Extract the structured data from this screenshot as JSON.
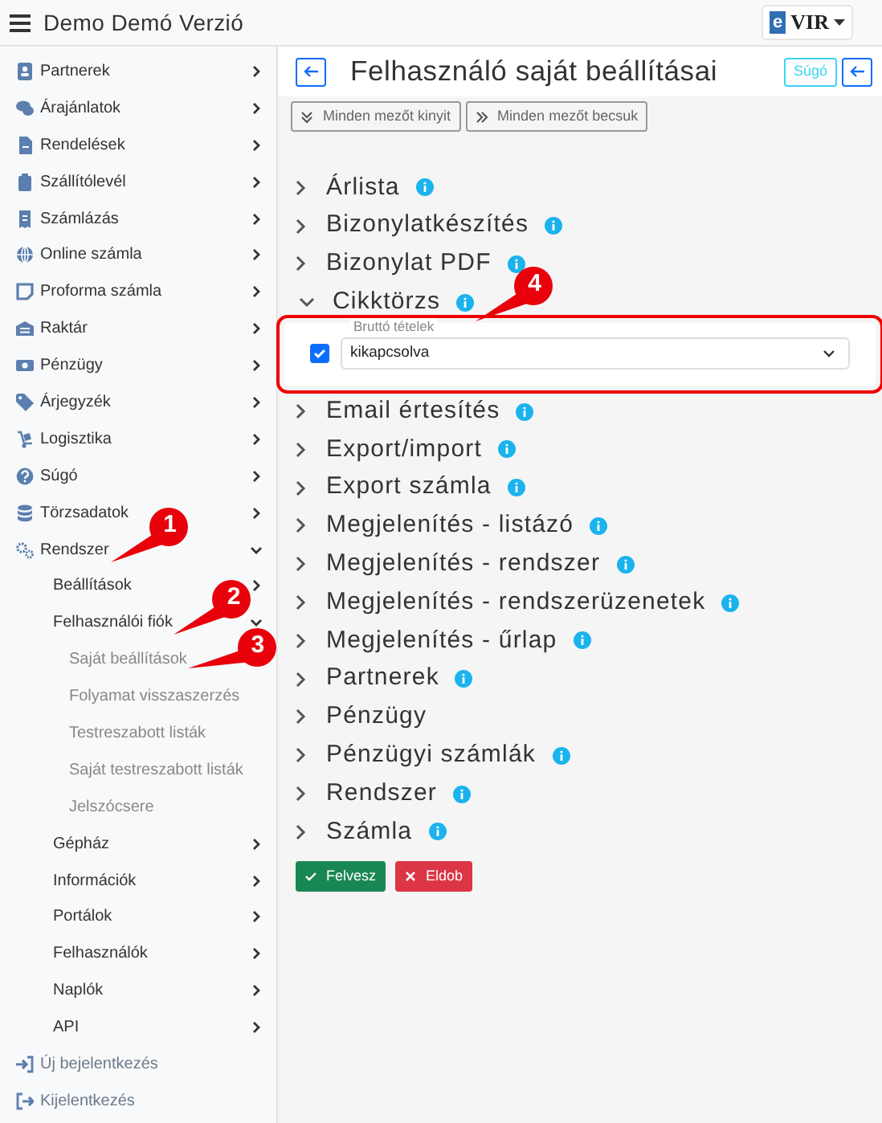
{
  "navbar": {
    "brand": "Demo Demó Verzió",
    "logo_mark": "e",
    "logo_text": "VIR"
  },
  "sidebar": {
    "items": [
      {
        "label": "Partnerek",
        "kind": "menu",
        "expanded": false
      },
      {
        "label": "Árajánlatok",
        "kind": "menu",
        "expanded": false
      },
      {
        "label": "Rendelések",
        "kind": "menu",
        "expanded": false
      },
      {
        "label": "Szállítólevél",
        "kind": "menu",
        "expanded": false
      },
      {
        "label": "Számlázás",
        "kind": "menu",
        "expanded": false
      },
      {
        "label": "Online számla",
        "kind": "menu",
        "expanded": false
      },
      {
        "label": "Proforma számla",
        "kind": "menu",
        "expanded": false
      },
      {
        "label": "Raktár",
        "kind": "menu",
        "expanded": false
      },
      {
        "label": "Pénzügy",
        "kind": "menu",
        "expanded": false
      },
      {
        "label": "Árjegyzék",
        "kind": "menu",
        "expanded": false
      },
      {
        "label": "Logisztika",
        "kind": "menu",
        "expanded": false
      },
      {
        "label": "Súgó",
        "kind": "menu",
        "expanded": false
      },
      {
        "label": "Törzsadatok",
        "kind": "menu",
        "expanded": false
      },
      {
        "label": "Rendszer",
        "kind": "menu",
        "expanded": true,
        "callout": "1",
        "children": [
          {
            "label": "Beállítások",
            "expanded": false
          },
          {
            "label": "Felhasználói fiók",
            "expanded": true,
            "callout": "2",
            "children": [
              {
                "label": "Saját beállítások",
                "callout": "3"
              },
              {
                "label": "Folyamat visszaszerzés"
              },
              {
                "label": "Testreszabott listák"
              },
              {
                "label": "Saját testreszabott listák"
              },
              {
                "label": "Jelszócsere"
              }
            ]
          },
          {
            "label": "Gépház",
            "expanded": false
          },
          {
            "label": "Információk",
            "expanded": false
          },
          {
            "label": "Portálok",
            "expanded": false
          },
          {
            "label": "Felhasználók",
            "expanded": false
          },
          {
            "label": "Naplók",
            "expanded": false
          },
          {
            "label": "API",
            "expanded": false
          }
        ]
      },
      {
        "label": "Új bejelentkezés",
        "kind": "action"
      },
      {
        "label": "Kijelentkezés",
        "kind": "action"
      }
    ]
  },
  "header": {
    "title": "Felhasználó saját beállításai",
    "help_button": "Súgó"
  },
  "toolbar": {
    "expand_all": "Minden mezőt kinyit",
    "collapse_all": "Minden mezőt becsuk"
  },
  "sections": [
    {
      "title": "Árlista",
      "info": true,
      "expanded": false
    },
    {
      "title": "Bizonylatkészítés",
      "info": true,
      "expanded": false
    },
    {
      "title": "Bizonylat PDF",
      "info": true,
      "expanded": false
    },
    {
      "title": "Cikktörzs",
      "info": true,
      "expanded": true,
      "callout": "4",
      "highlighted": true,
      "settings": [
        {
          "label": "Bruttó tételek",
          "value": "kikapcsolva",
          "checked": true
        }
      ]
    },
    {
      "title": "Email értesítés",
      "info": true,
      "expanded": false
    },
    {
      "title": "Export/import",
      "info": true,
      "expanded": false
    },
    {
      "title": "Export számla",
      "info": true,
      "expanded": false
    },
    {
      "title": "Megjelenítés - listázó",
      "info": true,
      "expanded": false
    },
    {
      "title": "Megjelenítés - rendszer",
      "info": true,
      "expanded": false
    },
    {
      "title": "Megjelenítés - rendszerüzenetek",
      "info": true,
      "expanded": false
    },
    {
      "title": "Megjelenítés - űrlap",
      "info": true,
      "expanded": false
    },
    {
      "title": "Partnerek",
      "info": true,
      "expanded": false
    },
    {
      "title": "Pénzügy",
      "info": false,
      "expanded": false
    },
    {
      "title": "Pénzügyi számlák",
      "info": true,
      "expanded": false
    },
    {
      "title": "Rendszer",
      "info": true,
      "expanded": false
    },
    {
      "title": "Számla",
      "info": true,
      "expanded": false
    }
  ],
  "actions": [
    {
      "label": "Felvesz",
      "kind": "save"
    },
    {
      "label": "Eldob",
      "kind": "discard"
    }
  ]
}
